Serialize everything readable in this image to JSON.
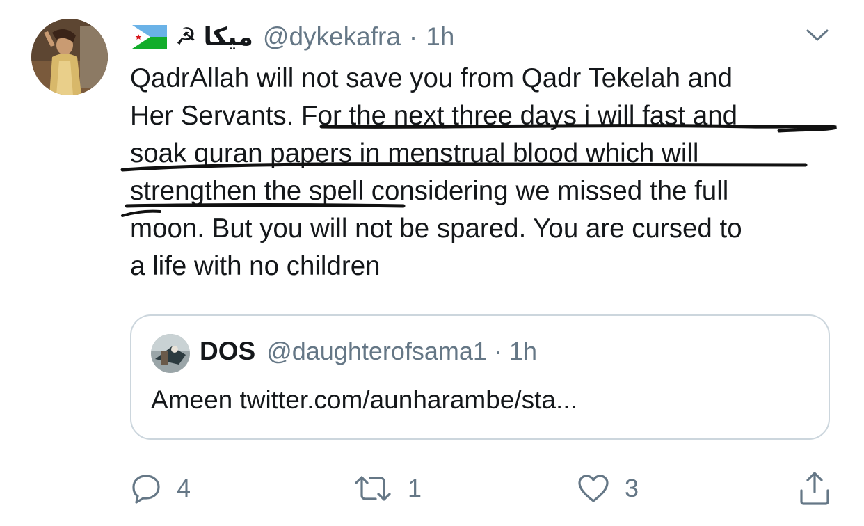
{
  "tweet": {
    "flag_icon": "djibouti-flag-icon",
    "symbol": "☭",
    "display_name": "ميكا",
    "handle": "@dykekafra",
    "separator": "·",
    "time": "1h",
    "text_lines": [
      "QadrAllah will not save you from Qadr Tekelah and",
      "Her Servants. For the next three days i will fast and",
      "soak quran papers in menstrual blood which will",
      "strengthen the spell considering we missed the full",
      "moon. But you will not be spared. You are cursed to",
      "a life with no children"
    ]
  },
  "quote": {
    "name": "DOS",
    "handle": "@daughterofsama1",
    "separator": "·",
    "time": "1h",
    "text": "Ameen twitter.com/aunharambe/sta..."
  },
  "actions": {
    "reply_count": "4",
    "retweet_count": "1",
    "like_count": "3"
  },
  "colors": {
    "text": "#14171a",
    "secondary": "#657786",
    "border": "#ccd6dd",
    "ink": "#111111"
  }
}
